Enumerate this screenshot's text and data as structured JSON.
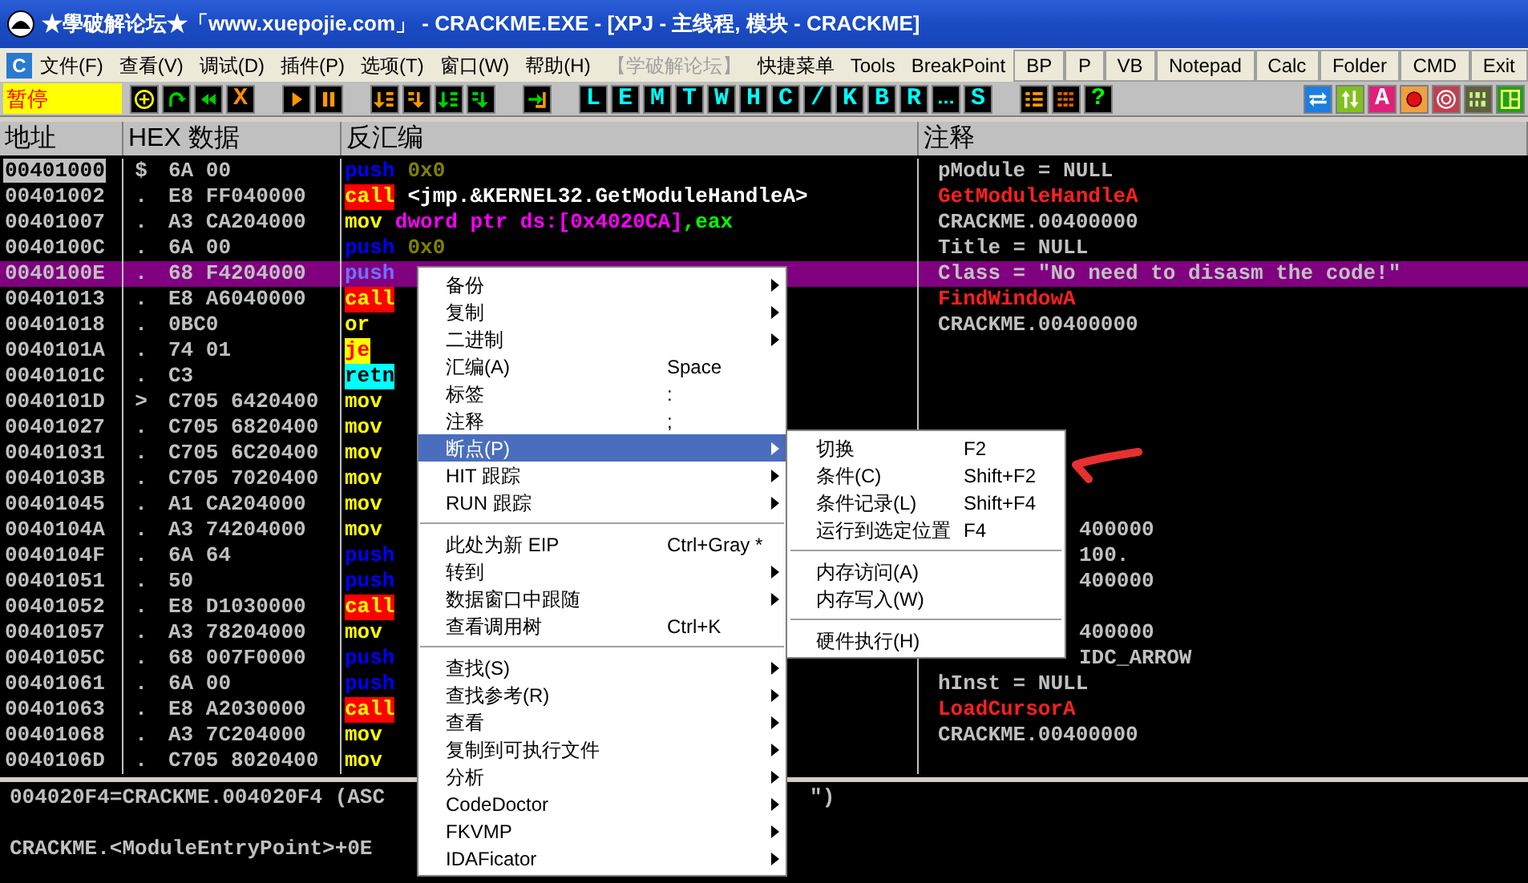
{
  "window": {
    "title": "★學破解论坛★「www.xuepojie.com」 - CRACKME.EXE - [XPJ - 主线程, 模块 - CRACKME]"
  },
  "menu_bar": {
    "app_icon_letter": "C",
    "items": [
      {
        "label": "文件(F)",
        "disabled": false
      },
      {
        "label": "查看(V)",
        "disabled": false
      },
      {
        "label": "调试(D)",
        "disabled": false
      },
      {
        "label": "插件(P)",
        "disabled": false
      },
      {
        "label": "选项(T)",
        "disabled": false
      },
      {
        "label": "窗口(W)",
        "disabled": false
      },
      {
        "label": "帮助(H)",
        "disabled": false
      },
      {
        "label": "【学破解论坛】",
        "disabled": true
      },
      {
        "label": "快捷菜单",
        "disabled": false
      },
      {
        "label": "Tools",
        "disabled": false
      },
      {
        "label": "BreakPoint",
        "disabled": false
      }
    ],
    "buttons": [
      "BP",
      "P",
      "VB",
      "Notepad",
      "Calc",
      "Folder",
      "CMD",
      "Exit"
    ]
  },
  "toolbar": {
    "status": "暂停",
    "groups": [
      [
        {
          "kind": "icon"
        },
        {
          "kind": "icon"
        },
        {
          "kind": "icon"
        },
        {
          "kind": "letter",
          "label": "X",
          "color": "#ff8c00"
        }
      ],
      [
        {
          "kind": "icon"
        },
        {
          "kind": "icon"
        }
      ],
      [
        {
          "kind": "icon"
        },
        {
          "kind": "icon"
        },
        {
          "kind": "icon"
        },
        {
          "kind": "icon"
        }
      ],
      [
        {
          "kind": "icon"
        }
      ],
      [
        {
          "kind": "letter",
          "label": "L",
          "color": "#00ffff"
        },
        {
          "kind": "letter",
          "label": "E",
          "color": "#00ffff"
        },
        {
          "kind": "letter",
          "label": "M",
          "color": "#00ffff"
        },
        {
          "kind": "letter",
          "label": "T",
          "color": "#00ffff"
        },
        {
          "kind": "letter",
          "label": "W",
          "color": "#00ffff"
        },
        {
          "kind": "letter",
          "label": "H",
          "color": "#00ffff"
        },
        {
          "kind": "letter",
          "label": "C",
          "color": "#00ffff"
        },
        {
          "kind": "letter",
          "label": "/",
          "color": "#00ffff"
        },
        {
          "kind": "letter",
          "label": "K",
          "color": "#00ffff"
        },
        {
          "kind": "letter",
          "label": "B",
          "color": "#00ffff"
        },
        {
          "kind": "letter",
          "label": "R",
          "color": "#00ffff"
        },
        {
          "kind": "icon"
        },
        {
          "kind": "letter",
          "label": "S",
          "color": "#00ffff"
        }
      ],
      [
        {
          "kind": "icon"
        },
        {
          "kind": "icon"
        },
        {
          "kind": "letter",
          "label": "?",
          "color": "#00ff00"
        }
      ]
    ],
    "right_group": [
      {
        "kind": "icon"
      },
      {
        "kind": "icon"
      },
      {
        "kind": "letter",
        "label": "A",
        "color": "#ffffff"
      },
      {
        "kind": "icon"
      },
      {
        "kind": "icon"
      },
      {
        "kind": "icon"
      },
      {
        "kind": "icon"
      }
    ]
  },
  "columns": [
    "地址",
    "HEX 数据",
    "反汇编",
    "注释"
  ],
  "rows": [
    {
      "address": "00401000",
      "mark": "$",
      "hex": "6A 00",
      "mnemonic": "push",
      "kind": "stack",
      "operands": [
        {
          "text": "0x0",
          "kind": "const"
        }
      ],
      "comment": {
        "text": "pModule = NULL",
        "kind": "plain"
      },
      "eip": true,
      "selected": false
    },
    {
      "address": "00401002",
      "mark": ".",
      "hex": "E8 FF040000",
      "mnemonic": "call",
      "kind": "invoke",
      "operands": [
        {
          "text": "<jmp.&KERNEL32.GetModuleHandleA>",
          "kind": "ref"
        }
      ],
      "comment": {
        "text": "GetModuleHandleA",
        "kind": "api"
      },
      "eip": false,
      "selected": false
    },
    {
      "address": "00401007",
      "mark": ".",
      "hex": "A3 CA204000",
      "mnemonic": "mov",
      "kind": "move",
      "operands": [
        {
          "text": "dword ptr ds:[0x4020CA]",
          "kind": "mem"
        },
        {
          "text": ",eax",
          "kind": "reg"
        }
      ],
      "comment": {
        "text": "CRACKME.00400000",
        "kind": "plain"
      },
      "eip": false,
      "selected": false
    },
    {
      "address": "0040100C",
      "mark": ".",
      "hex": "6A 00",
      "mnemonic": "push",
      "kind": "stack",
      "operands": [
        {
          "text": "0x0",
          "kind": "const"
        }
      ],
      "comment": {
        "text": "Title = NULL",
        "kind": "plain"
      },
      "eip": false,
      "selected": false
    },
    {
      "address": "0040100E",
      "mark": ".",
      "hex": "68 F4204000",
      "mnemonic": "push",
      "kind": "stack",
      "operands": [],
      "comment": {
        "text": "Class = \"No need to disasm the code!\"",
        "kind": "plain"
      },
      "eip": false,
      "selected": true
    },
    {
      "address": "00401013",
      "mark": ".",
      "hex": "E8 A6040000",
      "mnemonic": "call",
      "kind": "invoke",
      "operands": [],
      "comment": {
        "text": "FindWindowA",
        "kind": "api"
      },
      "eip": false,
      "selected": false
    },
    {
      "address": "00401018",
      "mark": ".",
      "hex": "0BC0",
      "mnemonic": "or",
      "kind": "move",
      "operands": [],
      "comment": {
        "text": "CRACKME.00400000",
        "kind": "plain"
      },
      "eip": false,
      "selected": false
    },
    {
      "address": "0040101A",
      "mark": ".",
      "hex": "74 01",
      "mnemonic": "je",
      "kind": "branch",
      "operands": [],
      "eip": false,
      "selected": false
    },
    {
      "address": "0040101C",
      "mark": ".",
      "hex": "C3",
      "mnemonic": "retn",
      "kind": "leave",
      "operands": [],
      "eip": false,
      "selected": false
    },
    {
      "address": "0040101D",
      "mark": ">",
      "hex": "C705 6420400",
      "mnemonic": "mov",
      "kind": "move",
      "operands": [],
      "eip": false,
      "selected": false
    },
    {
      "address": "00401027",
      "mark": ".",
      "hex": "C705 6820400",
      "mnemonic": "mov",
      "kind": "move",
      "operands": [],
      "eip": false,
      "selected": false
    },
    {
      "address": "00401031",
      "mark": ".",
      "hex": "C705 6C20400",
      "mnemonic": "mov",
      "kind": "move",
      "operands": [],
      "eip": false,
      "selected": false
    },
    {
      "address": "0040103B",
      "mark": ".",
      "hex": "C705 7020400",
      "mnemonic": "mov",
      "kind": "move",
      "operands": [],
      "eip": false,
      "selected": false
    },
    {
      "address": "00401045",
      "mark": ".",
      "hex": "A1 CA204000",
      "mnemonic": "mov",
      "kind": "move",
      "operands": [],
      "eip": false,
      "selected": false
    },
    {
      "address": "0040104A",
      "mark": ".",
      "hex": "A3 74204000",
      "mnemonic": "mov",
      "kind": "move",
      "operands": [],
      "comment": {
        "text": "400000",
        "kind": "tail"
      },
      "eip": false,
      "selected": false
    },
    {
      "address": "0040104F",
      "mark": ".",
      "hex": "6A 64",
      "mnemonic": "push",
      "kind": "stack",
      "operands": [],
      "comment": {
        "text": "100.",
        "kind": "tail"
      },
      "eip": false,
      "selected": false
    },
    {
      "address": "00401051",
      "mark": ".",
      "hex": "50",
      "mnemonic": "push",
      "kind": "stack",
      "operands": [],
      "comment": {
        "text": "400000",
        "kind": "tail"
      },
      "eip": false,
      "selected": false
    },
    {
      "address": "00401052",
      "mark": ".",
      "hex": "E8 D1030000",
      "mnemonic": "call",
      "kind": "invoke",
      "operands": [],
      "eip": false,
      "selected": false
    },
    {
      "address": "00401057",
      "mark": ".",
      "hex": "A3 78204000",
      "mnemonic": "mov",
      "kind": "move",
      "operands": [],
      "comment": {
        "text": "400000",
        "kind": "tail"
      },
      "eip": false,
      "selected": false
    },
    {
      "address": "0040105C",
      "mark": ".",
      "hex": "68 007F0000",
      "mnemonic": "push",
      "kind": "stack",
      "operands": [],
      "comment": {
        "text": "IDC_ARROW",
        "kind": "tail"
      },
      "eip": false,
      "selected": false
    },
    {
      "address": "00401061",
      "mark": ".",
      "hex": "6A 00",
      "mnemonic": "push",
      "kind": "stack",
      "operands": [],
      "comment": {
        "text": "hInst = NULL",
        "kind": "plain"
      },
      "eip": false,
      "selected": false
    },
    {
      "address": "00401063",
      "mark": ".",
      "hex": "E8 A2030000",
      "mnemonic": "call",
      "kind": "invoke",
      "operands": [],
      "comment": {
        "text": "LoadCursorA",
        "kind": "api"
      },
      "eip": false,
      "selected": false
    },
    {
      "address": "00401068",
      "mark": ".",
      "hex": "A3 7C204000",
      "mnemonic": "mov",
      "kind": "move",
      "operands": [],
      "comment": {
        "text": "CRACKME.00400000",
        "kind": "plain"
      },
      "eip": false,
      "selected": false
    },
    {
      "address": "0040106D",
      "mark": ".",
      "hex": "C705 8020400",
      "mnemonic": "mov",
      "kind": "move",
      "operands": [],
      "eip": false,
      "selected": false
    }
  ],
  "info_pane": {
    "line_1": "004020F4=CRACKME.004020F4 (ASC",
    "line_1_end": "\")",
    "line_3": "CRACKME.<ModuleEntryPoint>+0E"
  },
  "context_menu": {
    "items": [
      {
        "kind": "item",
        "label": "备份",
        "submenu": true,
        "selected": false
      },
      {
        "kind": "item",
        "label": "复制",
        "submenu": true,
        "selected": false
      },
      {
        "kind": "item",
        "label": "二进制",
        "submenu": true,
        "selected": false
      },
      {
        "kind": "item",
        "label": "汇编(A)",
        "shortcut": "Space",
        "submenu": false,
        "selected": false
      },
      {
        "kind": "item",
        "label": "标签",
        "shortcut": ":",
        "submenu": false,
        "selected": false
      },
      {
        "kind": "item",
        "label": "注释",
        "shortcut": ";",
        "submenu": false,
        "selected": false
      },
      {
        "kind": "item",
        "label": "断点(P)",
        "submenu": true,
        "selected": true
      },
      {
        "kind": "item",
        "label": "HIT 跟踪",
        "submenu": true,
        "selected": false
      },
      {
        "kind": "item",
        "label": "RUN 跟踪",
        "submenu": true,
        "selected": false
      },
      {
        "kind": "separator"
      },
      {
        "kind": "item",
        "label": "此处为新 EIP",
        "shortcut": "Ctrl+Gray *",
        "submenu": false,
        "selected": false
      },
      {
        "kind": "item",
        "label": "转到",
        "submenu": true,
        "selected": false
      },
      {
        "kind": "item",
        "label": "数据窗口中跟随",
        "submenu": true,
        "selected": false
      },
      {
        "kind": "item",
        "label": "查看调用树",
        "shortcut": "Ctrl+K",
        "submenu": false,
        "selected": false
      },
      {
        "kind": "separator"
      },
      {
        "kind": "item",
        "label": "查找(S)",
        "submenu": true,
        "selected": false
      },
      {
        "kind": "item",
        "label": "查找参考(R)",
        "submenu": true,
        "selected": false
      },
      {
        "kind": "item",
        "label": "查看",
        "submenu": true,
        "selected": false
      },
      {
        "kind": "item",
        "label": "复制到可执行文件",
        "submenu": true,
        "selected": false
      },
      {
        "kind": "item",
        "label": "分析",
        "submenu": true,
        "selected": false
      },
      {
        "kind": "item",
        "label": "CodeDoctor",
        "submenu": true,
        "selected": false
      },
      {
        "kind": "item",
        "label": "FKVMP",
        "submenu": true,
        "selected": false
      },
      {
        "kind": "item",
        "label": "IDAFicator",
        "submenu": true,
        "selected": false
      }
    ]
  },
  "breakpoint_submenu": {
    "items": [
      {
        "kind": "item",
        "label": "切换",
        "shortcut": "F2"
      },
      {
        "kind": "item",
        "label": "条件(C)",
        "shortcut": "Shift+F2"
      },
      {
        "kind": "item",
        "label": "条件记录(L)",
        "shortcut": "Shift+F4"
      },
      {
        "kind": "item",
        "label": "运行到选定位置",
        "shortcut": "F4"
      },
      {
        "kind": "separator"
      },
      {
        "kind": "item",
        "label": "内存访问(A)"
      },
      {
        "kind": "item",
        "label": "内存写入(W)"
      },
      {
        "kind": "separator"
      },
      {
        "kind": "item",
        "label": "硬件执行(H)"
      }
    ]
  }
}
